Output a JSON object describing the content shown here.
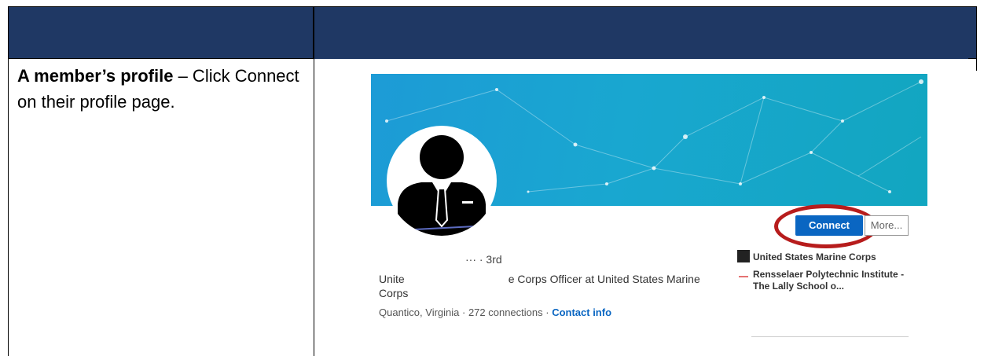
{
  "left_panel": {
    "bold_text": "A member’s profile",
    "rest_text": " – Click Connect on their profile page."
  },
  "profile": {
    "degree": "··· · 3rd",
    "headline_start": "Unite",
    "headline_end": "e Corps Officer at United States Marine Corps",
    "location": "Quantico, Virginia",
    "connections": "272 connections",
    "contact_info": "Contact info",
    "sep": " · ",
    "connect_label": "Connect",
    "more_label": "More...",
    "org1": "United States Marine Corps",
    "org2": "Rensselaer Polytechnic Institute - The Lally School o..."
  },
  "colors": {
    "header": "#1f3864",
    "banner": "#1d9bd6",
    "connect": "#0a66c2",
    "highlight_ring": "#b71c1c"
  },
  "icons": [
    "person-silhouette-icon",
    "network-pattern",
    "marine-corps-logo",
    "rpi-logo"
  ]
}
